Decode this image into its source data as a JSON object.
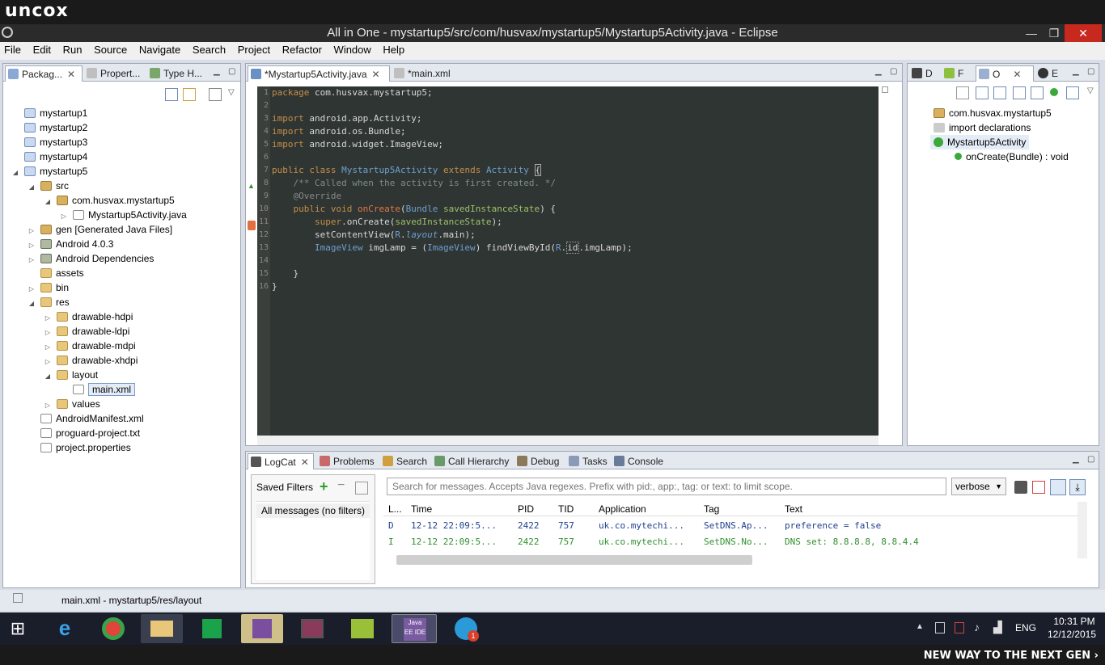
{
  "brand": "uncox",
  "window": {
    "title": "All in One - mystartup5/src/com/husvax/mystartup5/Mystartup5Activity.java - Eclipse",
    "minimize": "—",
    "maximize": "❐",
    "close": "✕"
  },
  "menu": [
    "File",
    "Edit",
    "Run",
    "Source",
    "Navigate",
    "Search",
    "Project",
    "Refactor",
    "Window",
    "Help"
  ],
  "left_panel": {
    "tabs": [
      {
        "label": "Packag...",
        "active": true,
        "icon": "package-explorer-icon"
      },
      {
        "label": "Propert...",
        "active": false,
        "icon": "properties-icon"
      },
      {
        "label": "Type H...",
        "active": false,
        "icon": "type-hierarchy-icon"
      }
    ],
    "tree": [
      {
        "label": "mystartup1",
        "depth": 0,
        "twisty": "",
        "icon": "proj"
      },
      {
        "label": "mystartup2",
        "depth": 0,
        "twisty": "",
        "icon": "proj"
      },
      {
        "label": "mystartup3",
        "depth": 0,
        "twisty": "",
        "icon": "proj"
      },
      {
        "label": "mystartup4",
        "depth": 0,
        "twisty": "",
        "icon": "proj"
      },
      {
        "label": "mystartup5",
        "depth": 0,
        "twisty": "◢",
        "icon": "proj"
      },
      {
        "label": "src",
        "depth": 1,
        "twisty": "◢",
        "icon": "pkg"
      },
      {
        "label": "com.husvax.mystartup5",
        "depth": 2,
        "twisty": "◢",
        "icon": "pkg"
      },
      {
        "label": "Mystartup5Activity.java",
        "depth": 3,
        "twisty": "▷",
        "icon": "file"
      },
      {
        "label": "gen [Generated Java Files]",
        "depth": 1,
        "twisty": "▷",
        "icon": "pkg"
      },
      {
        "label": "Android 4.0.3",
        "depth": 1,
        "twisty": "▷",
        "icon": "lib"
      },
      {
        "label": "Android Dependencies",
        "depth": 1,
        "twisty": "▷",
        "icon": "lib"
      },
      {
        "label": "assets",
        "depth": 1,
        "twisty": "",
        "icon": "folder"
      },
      {
        "label": "bin",
        "depth": 1,
        "twisty": "▷",
        "icon": "folder"
      },
      {
        "label": "res",
        "depth": 1,
        "twisty": "◢",
        "icon": "folder"
      },
      {
        "label": "drawable-hdpi",
        "depth": 2,
        "twisty": "▷",
        "icon": "folder"
      },
      {
        "label": "drawable-ldpi",
        "depth": 2,
        "twisty": "▷",
        "icon": "folder"
      },
      {
        "label": "drawable-mdpi",
        "depth": 2,
        "twisty": "▷",
        "icon": "folder"
      },
      {
        "label": "drawable-xhdpi",
        "depth": 2,
        "twisty": "▷",
        "icon": "folder"
      },
      {
        "label": "layout",
        "depth": 2,
        "twisty": "◢",
        "icon": "folder"
      },
      {
        "label": "main.xml",
        "depth": 3,
        "twisty": "",
        "icon": "file",
        "selected": true
      },
      {
        "label": "values",
        "depth": 2,
        "twisty": "▷",
        "icon": "folder"
      },
      {
        "label": "AndroidManifest.xml",
        "depth": 1,
        "twisty": "",
        "icon": "file"
      },
      {
        "label": "proguard-project.txt",
        "depth": 1,
        "twisty": "",
        "icon": "file"
      },
      {
        "label": "project.properties",
        "depth": 1,
        "twisty": "",
        "icon": "file"
      }
    ]
  },
  "editor": {
    "tabs": [
      {
        "label": "*Mystartup5Activity.java",
        "active": true,
        "icon": "java-file-icon"
      },
      {
        "label": "*main.xml",
        "active": false,
        "icon": "xml-file-icon"
      }
    ],
    "line_numbers": [
      "1",
      "2",
      "3",
      "4",
      "5",
      "6",
      "7",
      "8",
      "9",
      "10",
      "11",
      "12",
      "13",
      "14",
      "15",
      "16"
    ]
  },
  "outline_panel": {
    "tabs": [
      {
        "label": "D",
        "icon": "device-icon"
      },
      {
        "label": "F",
        "icon": "android-icon"
      },
      {
        "label": "O",
        "icon": "outline-icon",
        "active": true
      },
      {
        "label": "E",
        "icon": "emulator-icon"
      }
    ],
    "items": [
      {
        "label": "com.husvax.mystartup5",
        "icon": "package-icon"
      },
      {
        "label": "import declarations",
        "icon": "imports-icon"
      },
      {
        "label": "Mystartup5Activity",
        "icon": "class-icon",
        "selected": true
      },
      {
        "label": "onCreate(Bundle) : void",
        "icon": "method-icon"
      }
    ]
  },
  "bottom_panel": {
    "tabs": [
      {
        "label": "LogCat",
        "active": true,
        "icon": "logcat-icon"
      },
      {
        "label": "Problems",
        "icon": "problems-icon"
      },
      {
        "label": "Search",
        "icon": "search-icon"
      },
      {
        "label": "Call Hierarchy",
        "icon": "call-hierarchy-icon"
      },
      {
        "label": "Debug",
        "icon": "debug-icon"
      },
      {
        "label": "Tasks",
        "icon": "tasks-icon"
      },
      {
        "label": "Console",
        "icon": "console-icon"
      }
    ],
    "saved_filters_label": "Saved Filters",
    "filter_item": "All messages (no filters)",
    "search_placeholder": "Search for messages. Accepts Java regexes. Prefix with pid:, app:, tag: or text: to limit scope.",
    "level": "verbose",
    "columns": [
      "L...",
      "Time",
      "PID",
      "TID",
      "Application",
      "Tag",
      "Text"
    ],
    "rows": [
      {
        "level": "D",
        "time": "12-12 22:09:5...",
        "pid": "2422",
        "tid": "757",
        "app": "uk.co.mytechi...",
        "tag": "SetDNS.Ap...",
        "text": "preference = false",
        "color": "#1f3f8f"
      },
      {
        "level": "I",
        "time": "12-12 22:09:5...",
        "pid": "2422",
        "tid": "757",
        "app": "uk.co.mytechi...",
        "tag": "SetDNS.No...",
        "text": "DNS set: 8.8.8.8, 8.8.4.4",
        "color": "#2f8f2f"
      }
    ]
  },
  "status": {
    "text": "main.xml - mystartup5/res/layout"
  },
  "taskbar": {
    "lang": "ENG",
    "time": "10:31 PM",
    "date": "12/12/2015",
    "apps": [
      "start",
      "ie",
      "chrome",
      "explorer",
      "store",
      "visual-studio",
      "winrar",
      "bluestacks",
      "eclipse",
      "telegram"
    ],
    "telegram_badge": "1",
    "eclipse_label": "Java EE IDE"
  },
  "footer": "NEW WAY TO THE NEXT GEN ›"
}
